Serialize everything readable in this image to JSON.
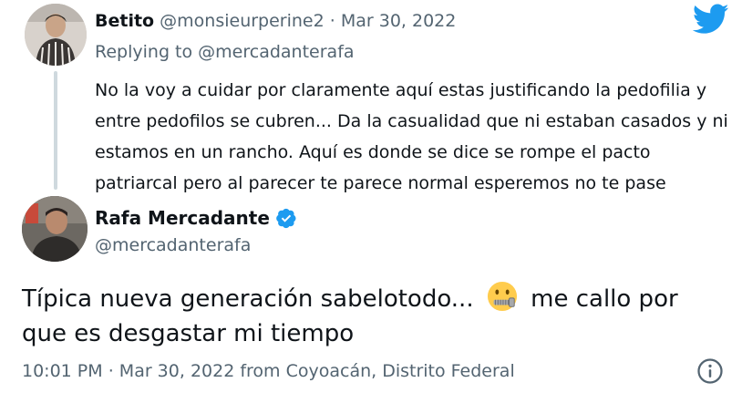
{
  "reply": {
    "author_name": "Betito",
    "author_handle": "@monsieurperine2",
    "separator": "·",
    "date": "Mar 30, 2022",
    "replying_to_label": "Replying to",
    "replying_to_handle": "@mercadanterafa",
    "text": "No la voy a cuidar por claramente aquí estas justificando la pedofilia y entre pedofilos se cubren... Da la casualidad que ni estaban casados y ni estamos en un rancho. Aquí es donde se dice se rompe el pacto patriarcal pero al parecer te parece normal esperemos no te pase"
  },
  "tweet": {
    "author_name": "Rafa Mercadante",
    "author_handle": "@mercadanterafa",
    "verified": true,
    "text_before_emoji": "Típica nueva generación sabelotodo...",
    "emoji": "zipper-mouth-face",
    "text_after_emoji": "me callo por que es desgastar mi tiempo",
    "timestamp": "10:01 PM",
    "separator": "·",
    "date_source": "Mar 30, 2022 from Coyoacán, Distrito Federal"
  },
  "colors": {
    "twitter_blue": "#1d9bf0",
    "secondary_text": "#536471",
    "primary_text": "#0f1419",
    "thread_line": "#cfd9de"
  }
}
